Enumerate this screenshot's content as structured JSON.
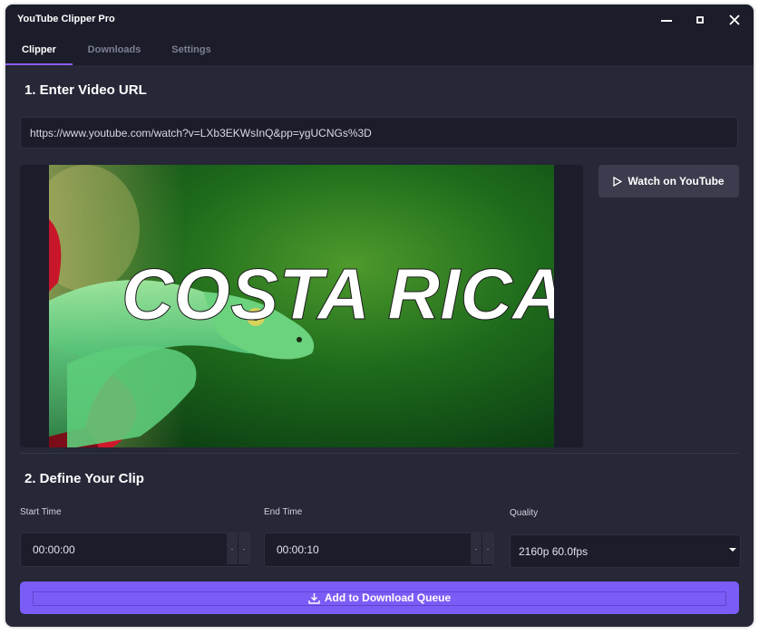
{
  "window": {
    "title": "YouTube Clipper Pro"
  },
  "tabs": [
    {
      "label": "Clipper",
      "active": true
    },
    {
      "label": "Downloads",
      "active": false
    },
    {
      "label": "Settings",
      "active": false
    }
  ],
  "section1": {
    "title": "1. Enter Video URL"
  },
  "url_input": {
    "value": "https://www.youtube.com/watch?v=LXb3EKWsInQ&pp=ygUCNGs%3D"
  },
  "video": {
    "thumbnail_text": "COSTA RICA"
  },
  "watch_button": {
    "label": "Watch on YouTube"
  },
  "section2": {
    "title": "2. Define Your Clip"
  },
  "start_time": {
    "label": "Start Time",
    "value": "00:00:00"
  },
  "end_time": {
    "label": "End Time",
    "value": "00:00:10"
  },
  "quality": {
    "label": "Quality",
    "value": "2160p 60.0fps"
  },
  "queue_button": {
    "label": "Add to Download Queue"
  },
  "colors": {
    "accent": "#7c5cf6",
    "background": "#262737",
    "surface": "#1c1d2b"
  }
}
